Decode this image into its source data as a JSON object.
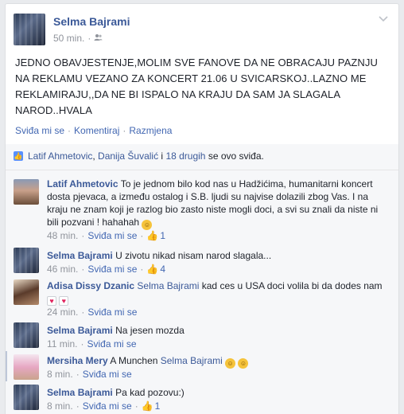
{
  "post": {
    "author": "Selma Bajrami",
    "time": "50 min.",
    "privacy_icon": "friends-icon",
    "body": "JEDNO OBAVJESTENJE,MOLIM SVE FANOVE DA NE OBRACAJU PAZNJU NA REKLAMU VEZANO ZA KONCERT 21.06 U SVICARSKOJ..LAZNO ME REKLAMIRAJU,,DA NE BI ISPALO NA KRAJU DA SAM JA SLAGALA NAROD..HVALA",
    "actions": {
      "like": "Sviđa mi se",
      "comment": "Komentiraj",
      "share": "Razmjena",
      "sep": "·"
    }
  },
  "likes": {
    "name1": "Latif Ahmetovic",
    "name2": "Danija Šuvalić",
    "connector": " i ",
    "others": "18 drugih",
    "suffix": " se ovo sviđa."
  },
  "comments": [
    {
      "author": "Latif Ahmetovic",
      "text": "To je jednom bilo kod nas u Hadžićima, humanitarni koncert dosta pjevaca, a između ostalog i S.B. ljudi su najvise dolazili zbog Vas. I na kraju ne znam koji je razlog bio zasto niste mogli doci, a svi su znali da niste ni bili pozvani ! hahahah",
      "time": "48 min.",
      "like": "Sviđa mi se",
      "likes": "1"
    },
    {
      "author": "Selma Bajrami",
      "text": "U zivotu nikad nisam narod slagala...",
      "time": "46 min.",
      "like": "Sviđa mi se",
      "likes": "4"
    },
    {
      "author": "Adisa Dissy Dzanic",
      "mention": "Selma Bajrami",
      "text": " kad ces u USA doci volila bi da dodes nam",
      "time": "24 min.",
      "like": "Sviđa mi se"
    },
    {
      "author": "Selma Bajrami",
      "text": "Na jesen mozda",
      "time": "11 min.",
      "like": "Sviđa mi se"
    },
    {
      "author": "Mersiha Mery",
      "text": "A Munchen ",
      "mention": "Selma Bajrami",
      "time": "8 min.",
      "like": "Sviđa mi se"
    },
    {
      "author": "Selma Bajrami",
      "text": "Pa kad pozovu:)",
      "time": "8 min.",
      "like": "Sviđa mi se",
      "likes": "1"
    }
  ]
}
